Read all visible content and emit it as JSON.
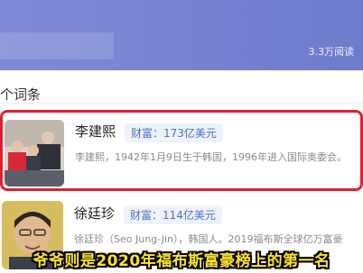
{
  "header": {
    "read_count": "3.3万阅读"
  },
  "section": {
    "label": "个词条"
  },
  "entries": [
    {
      "name": "李建熙",
      "wealth": "财富：173亿美元",
      "description": "李建熙，1942年1月9日生于韩国，1996年进入国际奥委会。"
    },
    {
      "name": "徐廷珍",
      "wealth": "财富：114亿美元",
      "description": "徐廷珍（Seo Jung-Jin），韩国人。2019福布斯全球亿万富豪"
    }
  ],
  "caption": "爷爷则是2020年福布斯富豪榜上的第一名",
  "colors": {
    "header_bg": "#7580d0",
    "highlight_border": "#e0202f",
    "badge_text": "#4a6fd1",
    "caption_text": "#ffe32a"
  }
}
